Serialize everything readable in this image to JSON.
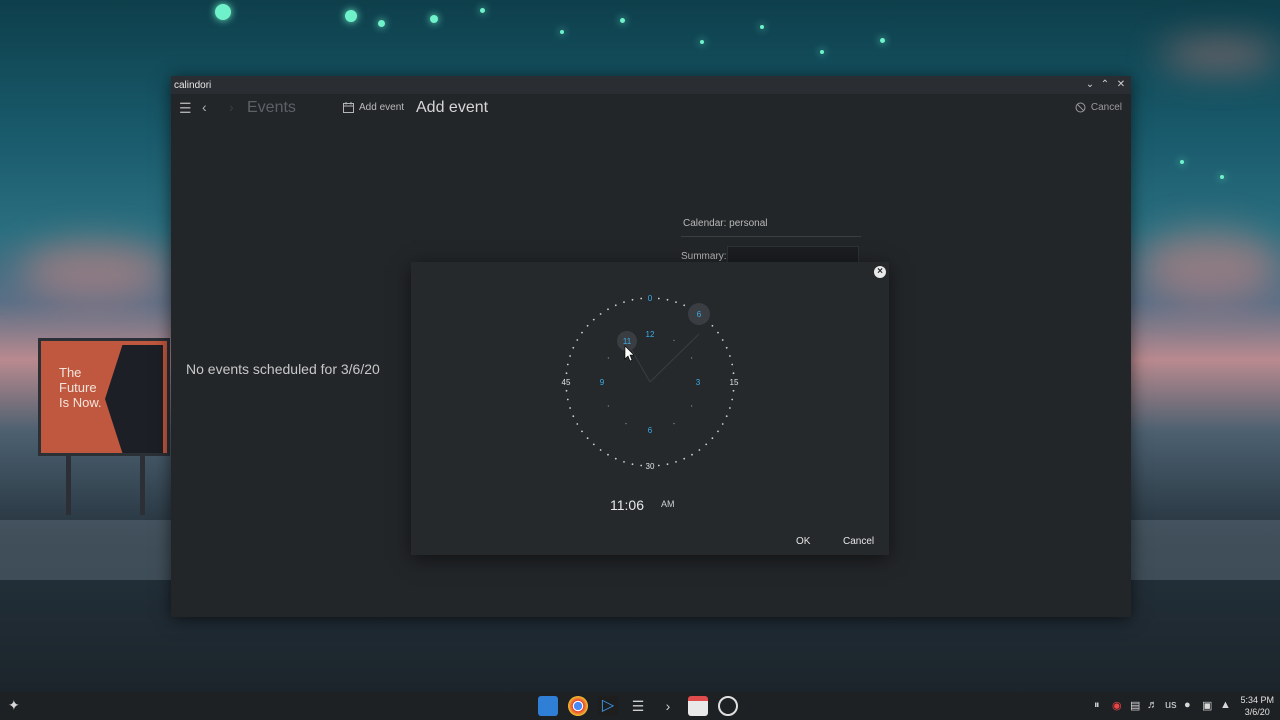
{
  "window": {
    "title": "calindori"
  },
  "toolbar": {
    "breadcrumb": "Events",
    "add_event_label": "Add event",
    "page_title": "Add event",
    "cancel_label": "Cancel"
  },
  "events": {
    "empty_message": "No events scheduled for 3/6/20"
  },
  "form": {
    "calendar_label": "Calendar: personal",
    "summary_label": "Summary:"
  },
  "time_picker": {
    "time": "11:06",
    "meridiem": "AM",
    "ok_label": "OK",
    "cancel_label": "Cancel",
    "minute_ticks": [
      "0",
      "15",
      "30",
      "45"
    ],
    "hour_ticks": [
      "12",
      "3",
      "6",
      "9"
    ],
    "selected_hour": "11",
    "selected_minute": "6"
  },
  "taskbar": {
    "keyboard_layout": "us",
    "time": "5:34 PM",
    "date": "3/6/20"
  },
  "colors": {
    "accent": "#3daee9",
    "window_bg": "#232629",
    "dialog_bg": "#25292c"
  }
}
